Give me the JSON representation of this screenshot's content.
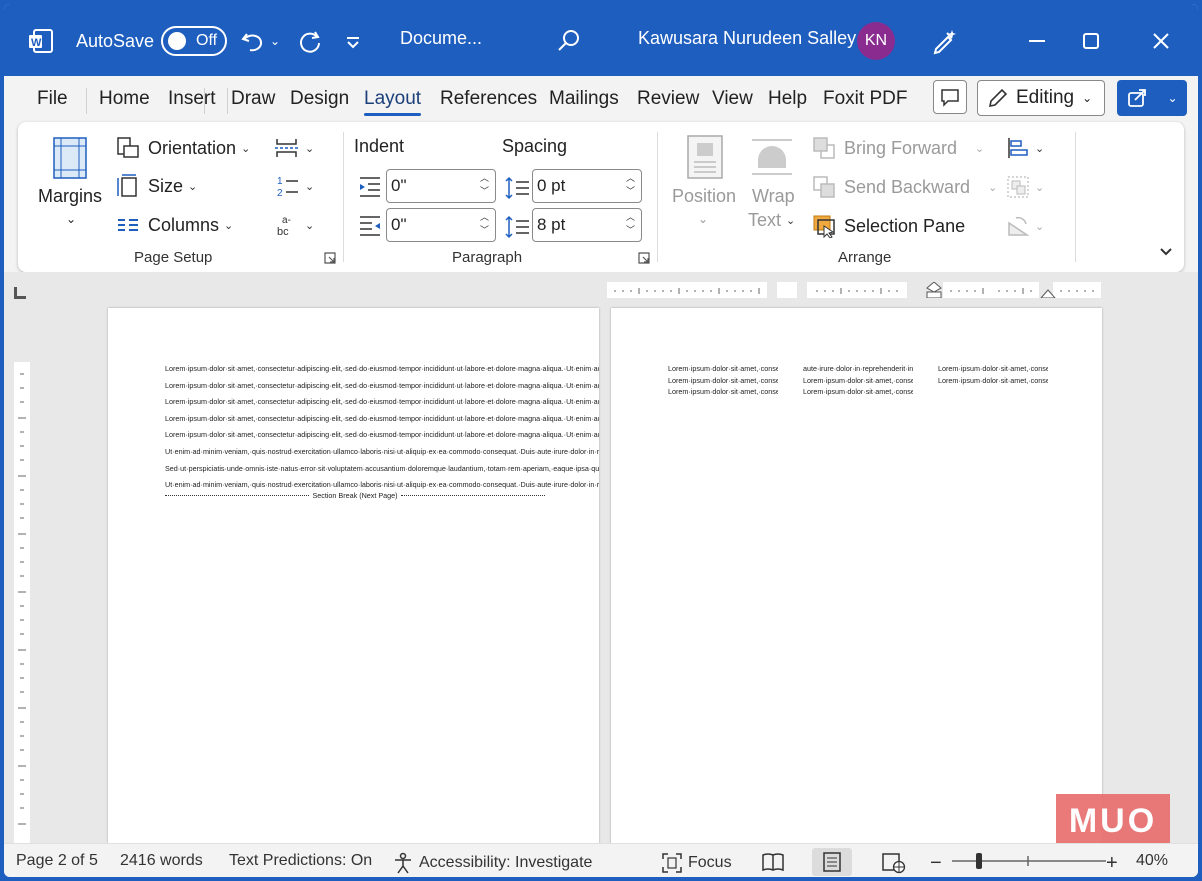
{
  "titlebar": {
    "autosave_label": "AutoSave",
    "autosave_state": "Off",
    "doc_title": "Docume...",
    "user_name": "Kawusara Nurudeen Salley",
    "user_initials": "KN"
  },
  "tabs": [
    "File",
    "Home",
    "Insert",
    "Draw",
    "Design",
    "Layout",
    "References",
    "Mailings",
    "Review",
    "View",
    "Help",
    "Foxit PDF"
  ],
  "active_tab": "Layout",
  "editing_label": "Editing",
  "ribbon": {
    "page_setup": {
      "margins": "Margins",
      "orientation": "Orientation",
      "size": "Size",
      "columns": "Columns",
      "label": "Page Setup"
    },
    "paragraph": {
      "indent_label": "Indent",
      "spacing_label": "Spacing",
      "indent_left": "0\"",
      "indent_right": "0\"",
      "spacing_before": "0 pt",
      "spacing_after": "8 pt",
      "label": "Paragraph"
    },
    "arrange": {
      "position": "Position",
      "wrap_text_1": "Wrap",
      "wrap_text_2": "Text",
      "bring_forward": "Bring Forward",
      "send_backward": "Send Backward",
      "selection_pane": "Selection Pane",
      "label": "Arrange"
    }
  },
  "document": {
    "p1_lorem": "Lorem·ipsum·dolor·sit·amet,·consectetur·adipiscing·elit,·sed·do·eiusmod·tempor·incididunt·ut·labore·et·dolore·magna·aliqua.·Ut·enim·ad·minim·veniam,·quis·nostrud·exercitation·ullamco·laboris·nisi·ut·aliquip·ex·ea·commodo·consequat.·Duis·aute·irure·dolor·in·reprehenderit·in·voluptate·velit·esse·cillum·dolore·eu·fugiat·nulla·pariatur.·Excepteur·sint·occaecat·cupidatat·non·proident,·sunt·in·culpa·qui·officia·deserunt·mollit·anim·id·est·laborum.¶",
    "p1_ut": "Ut·enim·ad·minim·veniam,·quis·nostrud·exercitation·ullamco·laboris·nisi·ut·aliquip·ex·ea·commodo·consequat.·Duis·aute·irure·dolor·in·reprehenderit·in·voluptate·velit·esse·cillum·dolore·eu·fugiat·nulla·pariatur.·Excepteur·sint·occaecat·cupidatat·non·proident,·sunt·in·culpa·qui·officia·deserunt·mollit·anim·id·est·laborum.¶",
    "p1_sed": "Sed·ut·perspiciatis·unde·omnis·iste·natus·error·sit·voluptatem·accusantium·doloremque·laudantium,·totam·rem·aperiam,·eaque·ipsa·quae·ab·illo·inventore·veritatis·et·quasi·architecto·beatae·vitae·dicta·sunt·explicabo.·Nemo·enim·ipsam·voluptatem·quia·voluptas·sit·aspernatur·aut·odit·aut·fugit,·sed·quia·consequuntur·magni·dolores·eos·qui·ratione·voluptatem·sequi·nesciunt.¶",
    "p1_last": "Ut·enim·ad·minim·veniam,·quis·nostrud·exercitation·ullamco·laboris·nisi·ut·aliquip·ex·ea·commodo·consequat.·Duis·aute·irure·dolor·in·reprehenderit·in·voluptate·velit·esse·cillum·dolore·eu·fugiat·nulla·pariatur.·Excepteur·sint·occaecat·cupidatat·non·proident,·sunt·in·culpa·qui·officia·deserunt·mollit·anim·id·est·laborum.",
    "section_break": "Section Break (Next Page)",
    "col1": "Lorem·ipsum·dolor·sit·amet,·consectetur·adipiscing·elit,·sed·do·eiusmod·tempor·incididunt·ut·labore·et·dolore·magna·aliqua.·Ut·enim·ad·minim·veniam,·quis·nostrud·exercitation·ullamco·laboris·nisi·ut·aliquip·ex·ea·commodo·consequat.·Duis·aute·irure·dolor·in·reprehenderit·in·voluptate·velit·esse·cillum·dolore·eu·fugiat·nulla·pariatur.·Excepteur·sint·occaecat·cupidatat·non·proident,·sunt·in·culpa·qui·officia·deserunt·mollit·anim·id·est·laborum.¶ Lorem·ipsum·dolor·sit·amet,·consectetur·adipiscing·elit,·sed·do·eiusmod·tempor·incididunt·ut·labore·et·dolore·magna·aliqua.·Ut·enim·ad·minim·veniam,·quis·nostrud·exercitation·ullamco·laboris·nisi·ut·aliquip·ex·ea·commodo·consequat.·Duis·aute·irure·dolor·in·reprehenderit·in·voluptate·velit·esse·cillum·dolore·eu·fugiat·nulla·pariatur.·Excepteur·sint·occaecat·cupidatat·non·proident,·sunt·in·culpa·qui·officia·deserunt·mollit·anim·id·est·laborum.¶ Lorem·ipsum·dolor·sit·amet,·consectetur·adipiscing·elit,·sed·do·eiusmod·tempor·incididunt·ut·labore·et·dolore·magna·aliqua.·Ut·enim·ad·minim·veniam,·quis·nostrud·",
    "col2": "aute·irure·dolor·in·reprehenderit·in·voluptate·velit·esse·cillum·dolore·eu·fugiat·nulla·pariatur.·Excepteur·sint·occaecat·cupidatat·non·proident,·sunt·in·culpa·qui·officia·deserunt·mollit·anim·id·est·laborum.¶ Lorem·ipsum·dolor·sit·amet,·consectetur·adipiscing·elit,·sed·do·eiusmod·tempor·incididunt·ut·labore·et·dolore·magna·aliqua.·Ut·enim·ad·minim·veniam,·quis·nostrud·exercitation·ullamco·laboris·nisi·ut·aliquip·ex·ea·commodo·consequat.·Duis·aute·irure·dolor·in·reprehenderit·in·voluptate·velit·esse·cillum·dolore·eu·fugiat·nulla·pariatur.·Excepteur·sint·occaecat·cupidatat·non·proident,·sunt·in·culpa·qui·officia·deserunt·mollit·anim·id·est·laborum.¶ Lorem·ipsum·dolor·sit·amet,·consectetur·adipiscing·elit,·sed·do·eiusmod·tempor·incididunt·ut·labore·et·dolore·magna·aliqua.·Ut·enim·ad·minim·veniam,·quis·nostrud·exercitation·ullamco·laboris·nisi·ut·aliquip·ex·ea·commodo·consequat.·Duis·aute·irure·dolor·in·reprehenderit·in·voluptate·velit·esse·cillum·dolore·eu·fugiat·nulla·pariatur.·Excepteur·sint·occaecat·cupidatat·non·proident,·sunt·",
    "col3": "Lorem·ipsum·dolor·sit·amet,·consectetur·adipiscing·elit,·sed·do·eiusmod·tempor·incididunt·ut·labore·et·dolore·magna·aliqua.·Ut·enim·ad·minim·veniam,·quis·nostrud·exercitation·ullamco·laboris·nisi·ut·aliquip·ex·ea·commodo·consequat.·Duis·aute·irure·dolor·in·reprehenderit·in·voluptate·velit·esse·cillum·dolore·eu·fugiat·nulla·pariatur.·Excepteur·sint·occaecat·cupidatat·non·proident,·sunt·in·culpa·qui·officia·deserunt·mollit·anim·id·est·laborum.¶ Lorem·ipsum·dolor·sit·amet,·consectetur·adipiscing·elit,·sed·do·eiusmod·tempor·incididunt·ut·labore·et·dolore·magna·aliqua.·Ut·enim·ad·minim·veniam,·quis·nostrud·exercitation·ullamco·laboris·nisi·ut·aliquip·ex·ea·commodo·consequat.·Duis·aute·irure·dolor·in·reprehenderit·in·voluptate·velit·esse·cillum·dolore·eu·fugiat·nulla·pariatur.·Excepteur·sint·occaecat·cupidatat·non·proident,·sunt·in·culpa·qui·officia·deserunt·mollit·anim·id·est·laborum.¶"
  },
  "watermark": "MUO",
  "statusbar": {
    "page": "Page 2 of 5",
    "words": "2416 words",
    "text_predictions": "Text Predictions: On",
    "accessibility": "Accessibility: Investigate",
    "focus": "Focus",
    "zoom": "40%"
  },
  "colors": {
    "accent": "#1e5ebf",
    "avatar": "#8a2b90",
    "watermark": "#e86b6b"
  }
}
